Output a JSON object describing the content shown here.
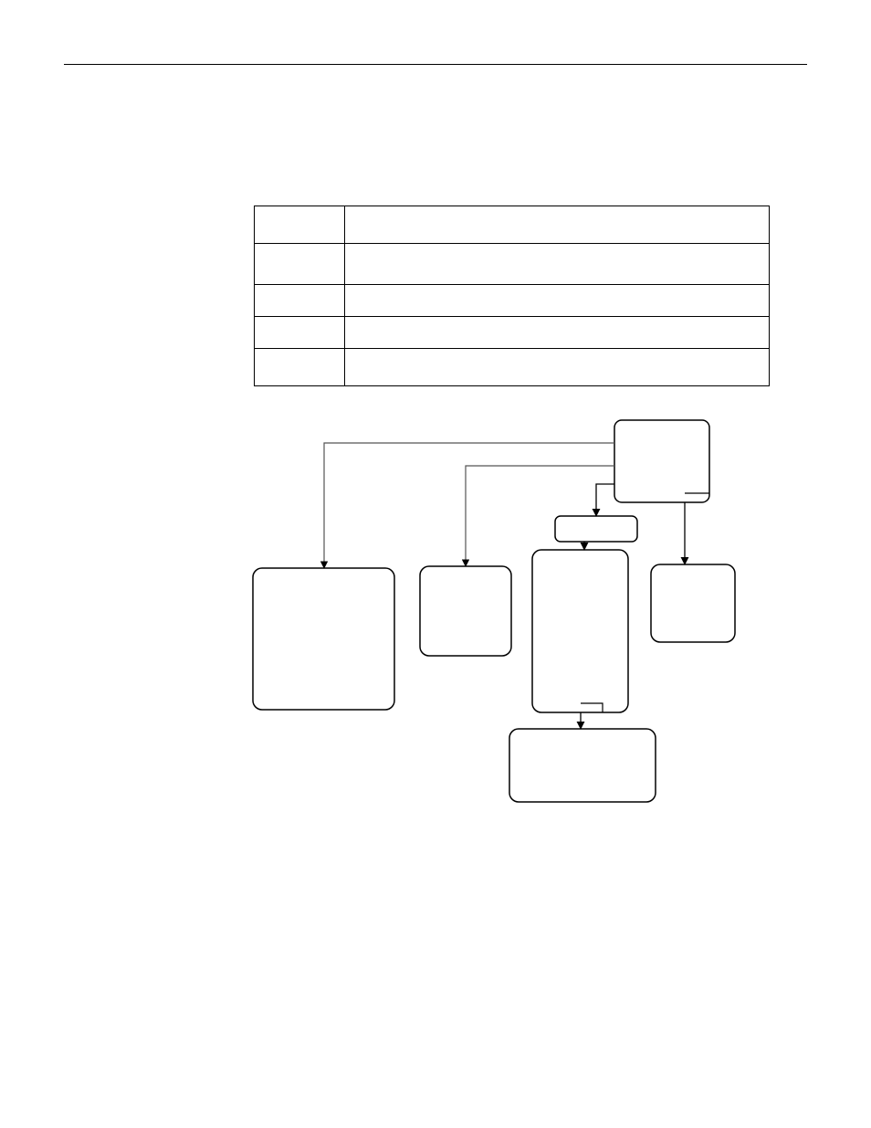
{
  "header": {
    "rule": true
  },
  "table": {
    "columns": 2,
    "rows": [
      {
        "c1": "",
        "c2": ""
      },
      {
        "c1": "",
        "c2": ""
      },
      {
        "c1": "",
        "c2": ""
      },
      {
        "c1": "",
        "c2": ""
      },
      {
        "c1": "",
        "c2": ""
      }
    ]
  },
  "flow": {
    "root": {
      "label": ""
    },
    "small": {
      "label": ""
    },
    "child1": {
      "label": ""
    },
    "child2": {
      "label": ""
    },
    "child3": {
      "label": ""
    },
    "child4": {
      "label": ""
    },
    "bottom": {
      "label": ""
    },
    "edges": [
      [
        "root",
        "child1"
      ],
      [
        "root",
        "child2"
      ],
      [
        "root",
        "small"
      ],
      [
        "root",
        "child4"
      ],
      [
        "small",
        "child3"
      ],
      [
        "child3",
        "bottom"
      ]
    ]
  }
}
